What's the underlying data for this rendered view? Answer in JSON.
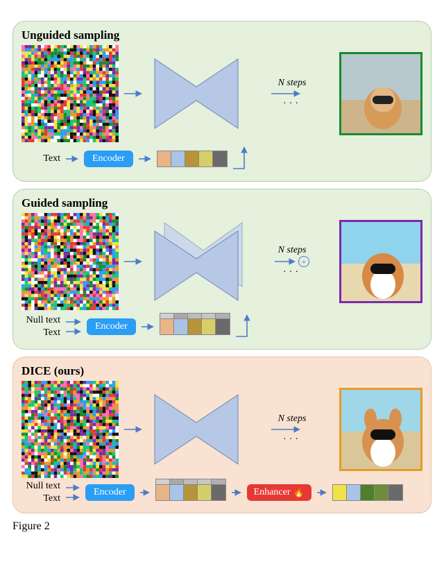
{
  "panels": {
    "unguided": {
      "title": "Unguided sampling",
      "steps_label": "N steps",
      "text_label": "Text",
      "encoder_label": "Encoder",
      "out_border": "#1a8a2f"
    },
    "guided": {
      "title": "Guided sampling",
      "steps_label": "N steps",
      "null_label": "Null text",
      "text_label": "Text",
      "encoder_label": "Encoder",
      "out_border": "#7a2aa8"
    },
    "dice": {
      "title": "DICE (ours)",
      "steps_label": "N steps",
      "null_label": "Null text",
      "text_label": "Text",
      "encoder_label": "Encoder",
      "enhancer_label": "Enhancer",
      "out_border": "#e59c27"
    }
  },
  "tokens": {
    "color": [
      "#e9b487",
      "#a9c4e6",
      "#b79339",
      "#d6cf67",
      "#6a6a6a"
    ],
    "gray": [
      "#d0d0d0",
      "#a8a8a8",
      "#bcbcbc",
      "#c7c7c7",
      "#b0b0b0"
    ],
    "color2": [
      "#e9b487",
      "#a9c4e6",
      "#b79339",
      "#d6cf67",
      "#6a6a6a"
    ],
    "enhanced": [
      "#f2e24a",
      "#a9c4e6",
      "#4f7f2d",
      "#6d8d3d",
      "#6a6a6a"
    ]
  },
  "caption": "Figure 2",
  "chart_data": {
    "type": "diagram",
    "description": "Three architecture panels comparing sampling pipelines for text-to-image diffusion.",
    "panels": [
      {
        "name": "Unguided sampling",
        "inputs": [
          "Text"
        ],
        "components": [
          "Encoder",
          "U-Net"
        ],
        "passes_per_step": 1,
        "steps": "N",
        "output_border": "green"
      },
      {
        "name": "Guided sampling",
        "inputs": [
          "Null text",
          "Text"
        ],
        "components": [
          "Encoder",
          "U-Net (x2, combined)"
        ],
        "passes_per_step": 2,
        "steps": "N",
        "output_border": "purple"
      },
      {
        "name": "DICE (ours)",
        "inputs": [
          "Null text",
          "Text"
        ],
        "components": [
          "Encoder",
          "Enhancer (trainable)",
          "U-Net"
        ],
        "passes_per_step": 1,
        "steps": "N",
        "output_border": "orange"
      }
    ]
  }
}
